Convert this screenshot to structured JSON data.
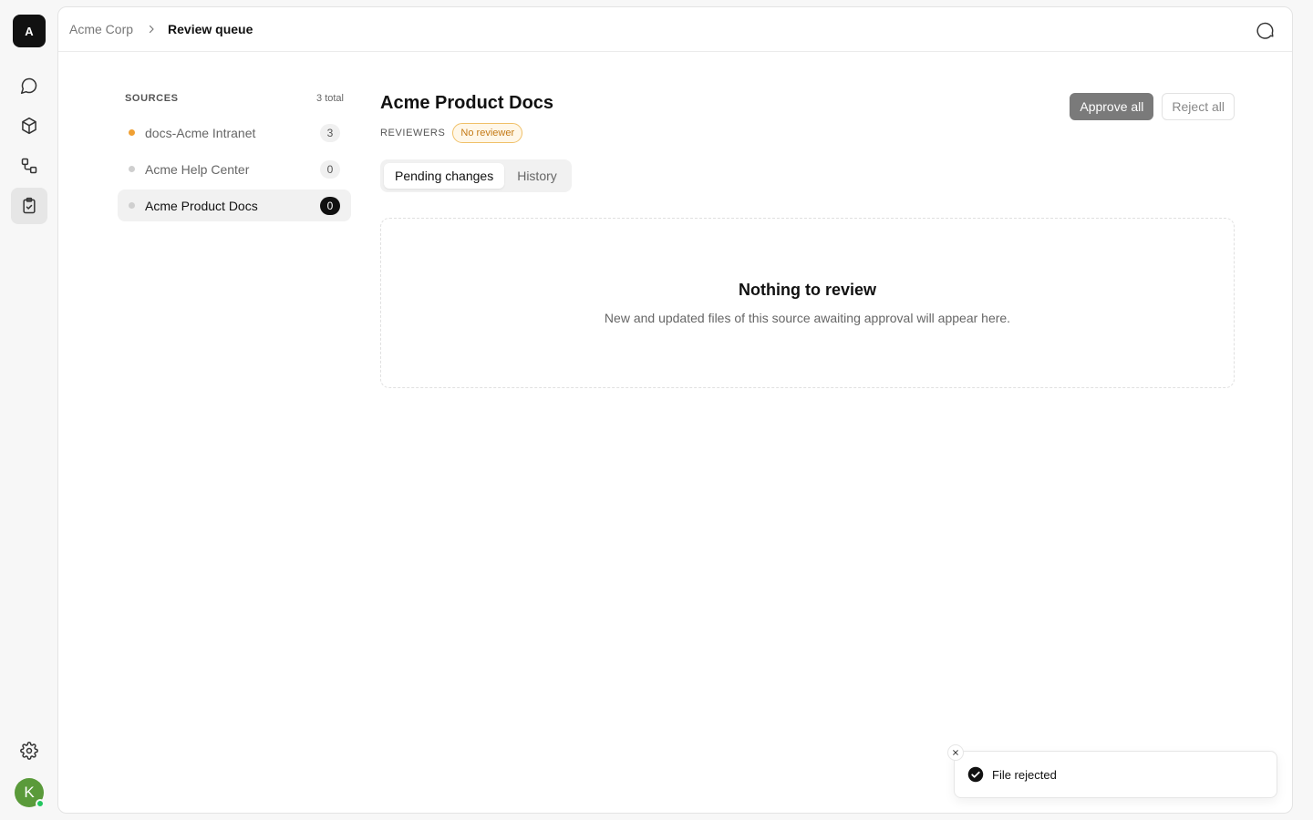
{
  "workspace": {
    "initial": "A"
  },
  "rail": {
    "items": [
      {
        "icon": "chat-icon"
      },
      {
        "icon": "cube-icon"
      },
      {
        "icon": "workflow-icon"
      },
      {
        "icon": "clipboard-check-icon",
        "active": true
      }
    ],
    "settings_icon": "gear-icon",
    "user": {
      "initial": "K",
      "status": "online"
    }
  },
  "header": {
    "breadcrumb": [
      "Acme Corp",
      "Review queue"
    ],
    "right_icon": "chat-bubble-icon"
  },
  "sources": {
    "title": "SOURCES",
    "total": "3 total",
    "items": [
      {
        "label": "docs-Acme Intranet",
        "count": "3",
        "dot": "orange"
      },
      {
        "label": "Acme Help Center",
        "count": "0",
        "dot": "gray"
      },
      {
        "label": "Acme Product Docs",
        "count": "0",
        "dot": "gray",
        "active": true
      }
    ]
  },
  "content": {
    "title": "Acme Product Docs",
    "reviewers_label": "REVIEWERS",
    "reviewer_badge": "No reviewer",
    "approve_label": "Approve all",
    "reject_label": "Reject all",
    "tabs": [
      {
        "label": "Pending changes",
        "active": true
      },
      {
        "label": "History"
      }
    ],
    "empty": {
      "title": "Nothing to review",
      "description": "New and updated files of this source awaiting approval will appear here."
    }
  },
  "toast": {
    "message": "File rejected",
    "icon": "check-circle-icon"
  },
  "colors": {
    "accent_orange": "#f0a033",
    "online": "#22c55e",
    "avatar": "#5a9a3a"
  }
}
